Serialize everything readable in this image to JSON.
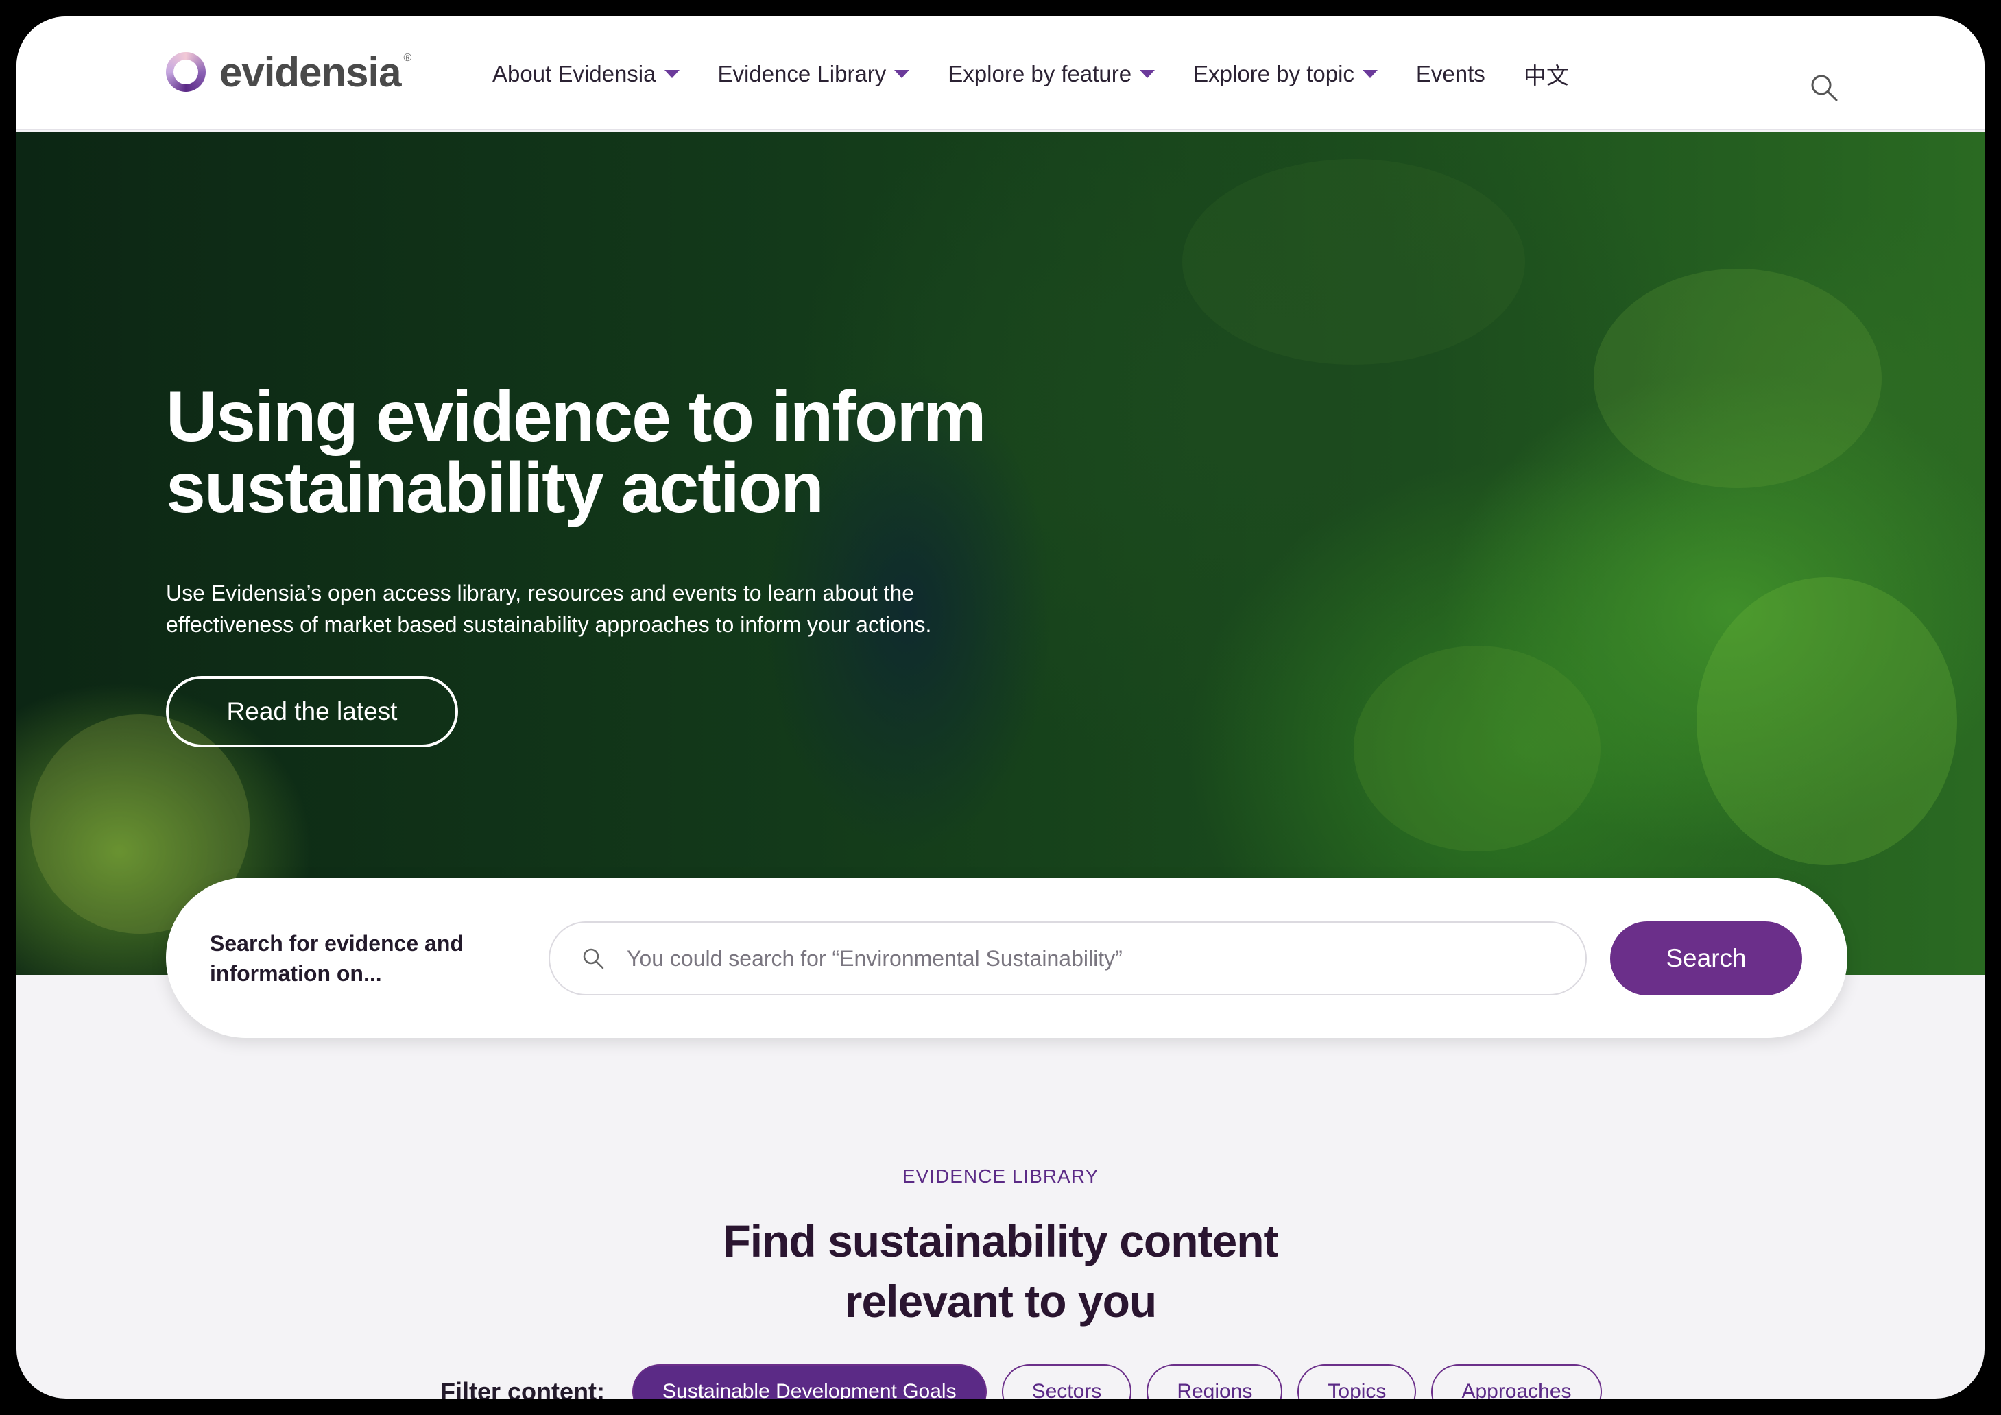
{
  "brand": {
    "name": "evidensia",
    "reg": "®"
  },
  "nav": {
    "items": [
      {
        "label": "About Evidensia",
        "dropdown": true
      },
      {
        "label": "Evidence Library",
        "dropdown": true
      },
      {
        "label": "Explore by feature",
        "dropdown": true
      },
      {
        "label": "Explore by topic",
        "dropdown": true
      },
      {
        "label": "Events",
        "dropdown": false
      },
      {
        "label": "中文",
        "dropdown": false
      }
    ],
    "search_icon": "search-icon"
  },
  "hero": {
    "title_line1": "Using evidence to inform",
    "title_line2": "sustainability action",
    "subtitle_line1": "Use Evidensia’s open access library, resources and events to learn about the",
    "subtitle_line2": "effectiveness of market based sustainability approaches to inform your actions.",
    "cta_label": "Read the latest"
  },
  "search": {
    "label_line1": "Search for evidence and",
    "label_line2": "information on...",
    "placeholder": "You could search for “Environmental Sustainability”",
    "value": "",
    "button_label": "Search"
  },
  "library": {
    "kicker": "EVIDENCE LIBRARY",
    "title_line1": "Find sustainability content",
    "title_line2": "relevant to you",
    "filter_label": "Filter content:",
    "filters": [
      {
        "label": "Sustainable Development Goals",
        "active": true
      },
      {
        "label": "Sectors",
        "active": false
      },
      {
        "label": "Regions",
        "active": false
      },
      {
        "label": "Topics",
        "active": false
      },
      {
        "label": "Approaches",
        "active": false
      }
    ]
  },
  "colors": {
    "brand_purple": "#6b2f8a",
    "heading_dark": "#2a1530",
    "page_bg": "#f4f3f6"
  }
}
